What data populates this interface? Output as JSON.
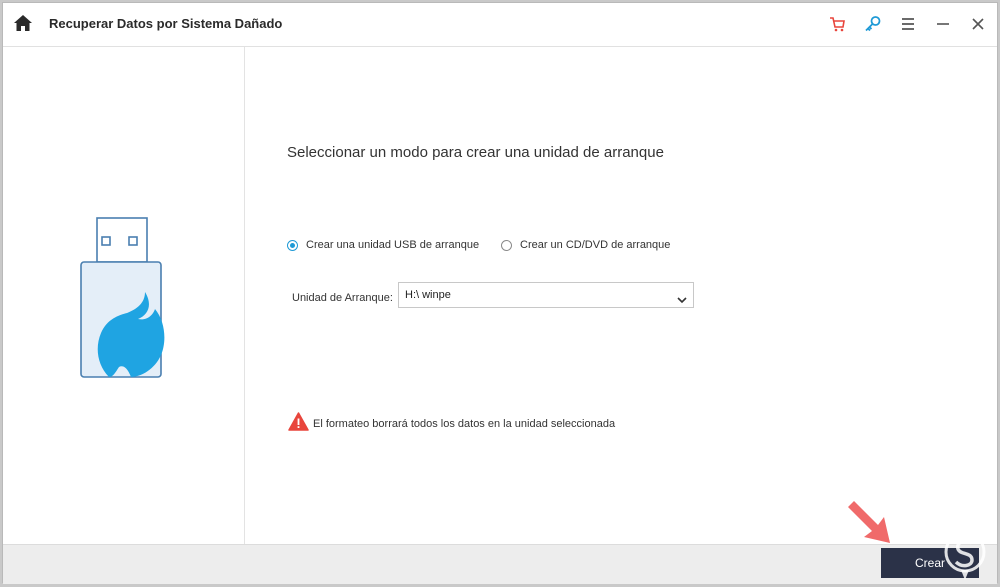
{
  "app": {
    "title": "Recuperar Datos por Sistema Dañado"
  },
  "titlebar": {
    "icons": [
      "home-icon",
      "cart-icon",
      "key-icon",
      "menu-icon",
      "minimize-icon",
      "close-icon"
    ],
    "accent_colors": {
      "cart": "#e8453c",
      "key": "#1f9ad6",
      "default": "#555555"
    }
  },
  "main": {
    "heading": "Seleccionar un modo para crear una unidad de arranque",
    "options": [
      {
        "label": "Crear una unidad USB de arranque",
        "checked": true
      },
      {
        "label": "Crear un CD/DVD de arranque",
        "checked": false
      }
    ],
    "drive": {
      "label": "Unidad de Arranque:",
      "value": "H:\\ winpe"
    },
    "warning": "El formateo borrará todos los datos en la unidad seleccionada"
  },
  "footer": {
    "create_label": "Crear"
  },
  "colors": {
    "accent": "#1f9ad6",
    "button": "#2b3248",
    "warning": "#e8453c",
    "annotation_arrow": "#f06a6a"
  }
}
